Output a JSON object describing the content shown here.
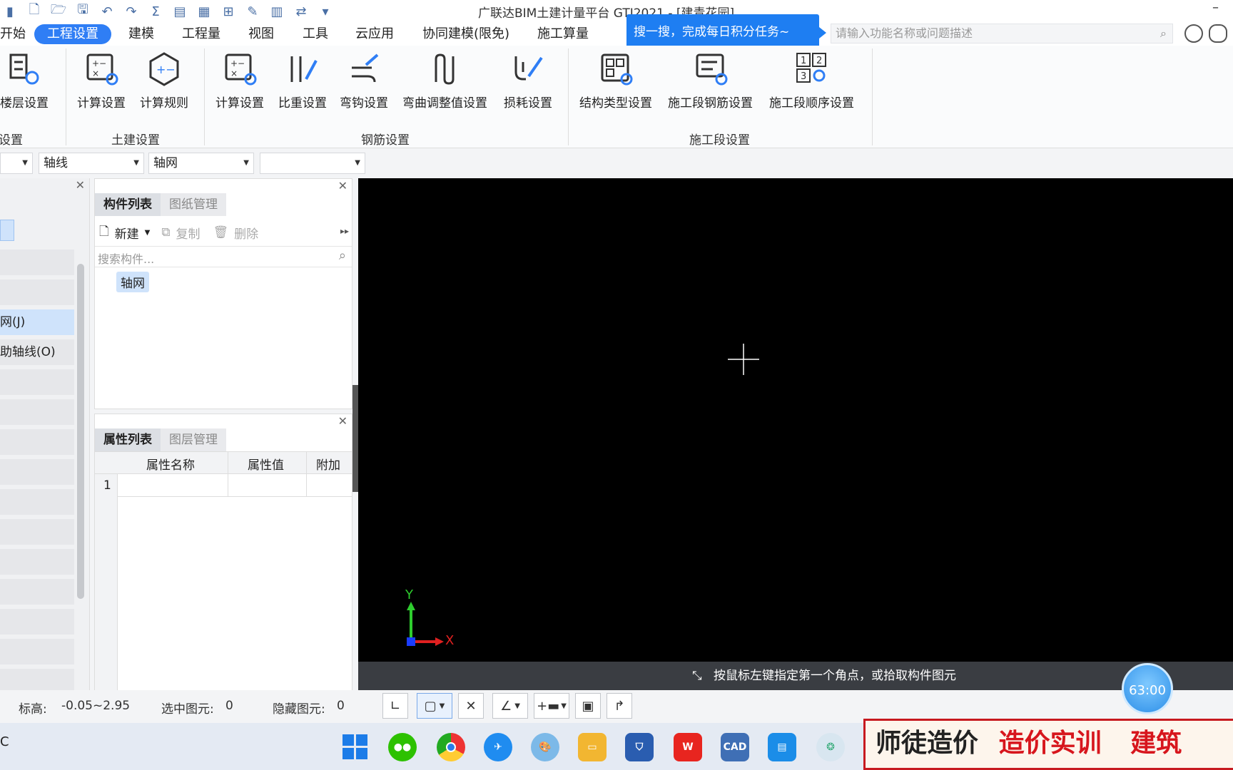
{
  "app": {
    "title": "广联达BIM土建计量平台 GTJ2021 - [建青花园]"
  },
  "menu": {
    "items": [
      "开始",
      "工程设置",
      "建模",
      "工程量",
      "视图",
      "工具",
      "云应用",
      "协同建模(限免)",
      "施工算量"
    ],
    "active": "工程设置"
  },
  "search": {
    "tip": "搜一搜，完成每日积分任务~",
    "placeholder": "请输入功能名称或问题描述"
  },
  "ribbon": {
    "buttons": [
      "楼层设置",
      "计算设置",
      "计算规则",
      "计算设置",
      "比重设置",
      "弯钩设置",
      "弯曲调整值设置",
      "损耗设置",
      "结构类型设置",
      "施工段钢筋设置",
      "施工段顺序设置"
    ],
    "groups": [
      "设置",
      "土建设置",
      "钢筋设置",
      "施工段设置"
    ]
  },
  "dropdowns": [
    "",
    "轴线",
    "轴网",
    ""
  ],
  "nav": {
    "items": [
      "网(J)",
      "助轴线(O)"
    ]
  },
  "component_panel": {
    "tabs": [
      "构件列表",
      "图纸管理"
    ],
    "new_label": "新建",
    "copy_label": "复制",
    "delete_label": "删除",
    "search_placeholder": "搜索构件...",
    "items": [
      "轴网"
    ]
  },
  "property_panel": {
    "tabs": [
      "属性列表",
      "图层管理"
    ],
    "columns": [
      "属性名称",
      "属性值",
      "附加"
    ],
    "rows": [
      "1"
    ]
  },
  "canvas": {
    "axis_y": "Y",
    "axis_x": "X",
    "hint": "按鼠标左键指定第一个角点，或拾取构件图元"
  },
  "status": {
    "elevation_label": "标高:",
    "elevation_value": "-0.05~2.95",
    "selected_label": "选中图元:",
    "selected_value": "0",
    "hidden_label": "隐藏图元:",
    "hidden_value": "0"
  },
  "timer": "63:00",
  "taskbar": {
    "left_text": "C",
    "cad_label": "CAD"
  },
  "banner": {
    "text1": "师徒造价",
    "text2": "造价实训",
    "text3": "建筑"
  },
  "colors": {
    "accent": "#2f7ef5",
    "banner_red": "#c7191f",
    "canvas": "#000000"
  }
}
